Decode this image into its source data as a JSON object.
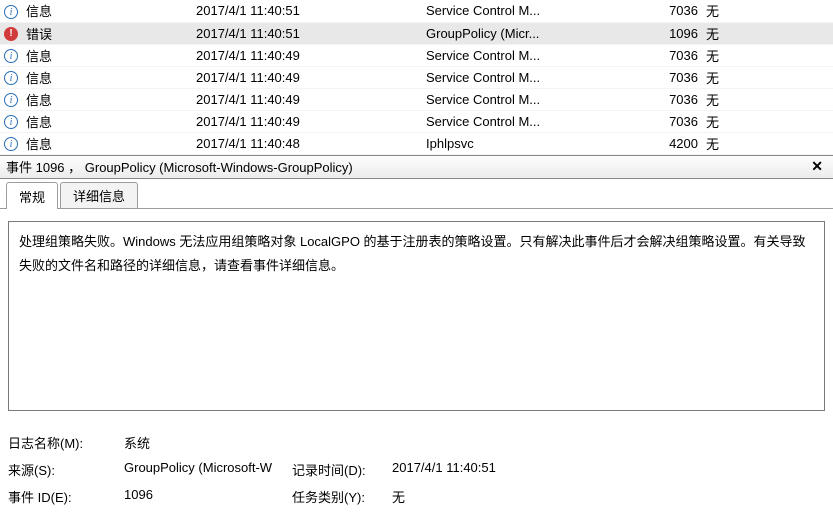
{
  "rows": [
    {
      "level": "信息",
      "icon": "info",
      "time": "2017/4/1 11:40:51",
      "source": "Service Control M...",
      "id": "7036",
      "cat": "无",
      "selected": false
    },
    {
      "level": "错误",
      "icon": "error",
      "time": "2017/4/1 11:40:51",
      "source": "GroupPolicy (Micr...",
      "id": "1096",
      "cat": "无",
      "selected": true
    },
    {
      "level": "信息",
      "icon": "info",
      "time": "2017/4/1 11:40:49",
      "source": "Service Control M...",
      "id": "7036",
      "cat": "无",
      "selected": false
    },
    {
      "level": "信息",
      "icon": "info",
      "time": "2017/4/1 11:40:49",
      "source": "Service Control M...",
      "id": "7036",
      "cat": "无",
      "selected": false
    },
    {
      "level": "信息",
      "icon": "info",
      "time": "2017/4/1 11:40:49",
      "source": "Service Control M...",
      "id": "7036",
      "cat": "无",
      "selected": false
    },
    {
      "level": "信息",
      "icon": "info",
      "time": "2017/4/1 11:40:49",
      "source": "Service Control M...",
      "id": "7036",
      "cat": "无",
      "selected": false
    },
    {
      "level": "信息",
      "icon": "info",
      "time": "2017/4/1 11:40:48",
      "source": "Iphlpsvc",
      "id": "4200",
      "cat": "无",
      "selected": false
    }
  ],
  "detail": {
    "title": "事件 1096 ， GroupPolicy (Microsoft-Windows-GroupPolicy)",
    "tabs": {
      "general": "常规",
      "details": "详细信息"
    },
    "description": "处理组策略失败。Windows 无法应用组策略对象 LocalGPO 的基于注册表的策略设置。只有解决此事件后才会解决组策略设置。有关导致失败的文件名和路径的详细信息，请查看事件详细信息。",
    "props": {
      "logname_label": "日志名称(M):",
      "logname_value": "系统",
      "source_label": "来源(S):",
      "source_value": "GroupPolicy (Microsoft-W",
      "logged_label": "记录时间(D):",
      "logged_value": "2017/4/1 11:40:51",
      "eventid_label": "事件 ID(E):",
      "eventid_value": "1096",
      "taskcat_label": "任务类别(Y):",
      "taskcat_value": "无"
    }
  }
}
